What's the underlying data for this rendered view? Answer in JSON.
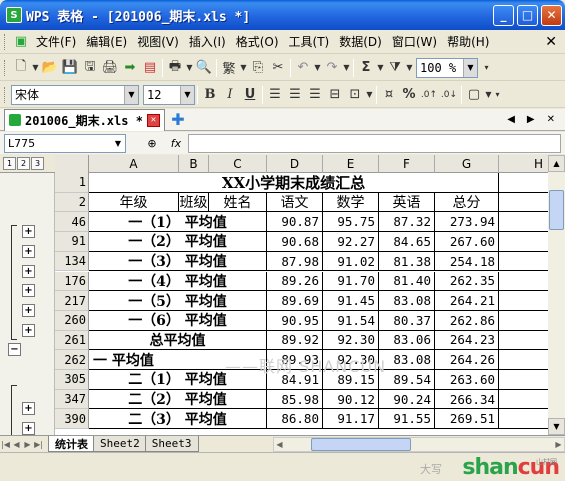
{
  "window": {
    "title": "WPS 表格 - [201006_期末.xls *]"
  },
  "menu": [
    "文件(F)",
    "编辑(E)",
    "视图(V)",
    "插入(I)",
    "格式(O)",
    "工具(T)",
    "数据(D)",
    "窗口(W)",
    "帮助(H)"
  ],
  "toolbar": {
    "zoom": "100 %",
    "font_name": "宋体",
    "font_size": "12",
    "bold": "B",
    "italic": "I",
    "underline": "U",
    "percent": "%",
    "sum": "Σ"
  },
  "doc_tab": {
    "label": "201006_期末.xls *"
  },
  "formula_bar": {
    "cell_ref": "L775",
    "fx_label": "fx",
    "formula": ""
  },
  "outline_levels": [
    "1",
    "2",
    "3"
  ],
  "columns": [
    "A",
    "B",
    "C",
    "D",
    "E",
    "F",
    "G",
    "H"
  ],
  "sheet": {
    "title": "XX小学期末成绩汇总",
    "header": [
      "年级",
      "班级",
      "姓名",
      "语文",
      "数学",
      "英语",
      "总分"
    ],
    "rows": [
      {
        "row": "46",
        "label": "一（1） 平均值",
        "v": [
          "90.87",
          "95.75",
          "87.32",
          "273.94"
        ]
      },
      {
        "row": "91",
        "label": "一（2） 平均值",
        "v": [
          "90.68",
          "92.27",
          "84.65",
          "267.60"
        ]
      },
      {
        "row": "134",
        "label": "一（3） 平均值",
        "v": [
          "87.98",
          "91.02",
          "81.38",
          "254.18"
        ]
      },
      {
        "row": "176",
        "label": "一（4） 平均值",
        "v": [
          "89.26",
          "91.70",
          "81.40",
          "262.35"
        ]
      },
      {
        "row": "217",
        "label": "一（5） 平均值",
        "v": [
          "89.69",
          "91.45",
          "83.08",
          "264.21"
        ]
      },
      {
        "row": "260",
        "label": "一（6） 平均值",
        "v": [
          "90.95",
          "91.54",
          "80.37",
          "262.86"
        ]
      },
      {
        "row": "261",
        "label": "总平均值",
        "v": [
          "89.92",
          "92.30",
          "83.06",
          "264.23"
        ]
      },
      {
        "row": "262",
        "label": "一 平均值",
        "v": [
          "89.93",
          "92.30",
          "83.08",
          "264.26"
        ]
      },
      {
        "row": "305",
        "label": "二（1） 平均值",
        "v": [
          "84.91",
          "89.15",
          "89.54",
          "263.60"
        ]
      },
      {
        "row": "347",
        "label": "二（2） 平均值",
        "v": [
          "85.98",
          "90.12",
          "90.24",
          "266.34"
        ]
      },
      {
        "row": "390",
        "label": "二（3） 平均值",
        "v": [
          "86.80",
          "91.17",
          "91.55",
          "269.51"
        ]
      }
    ]
  },
  "watermark": "——联网 SHANCUN",
  "sheet_tabs": [
    "统计表",
    "Sheet2",
    "Sheet3"
  ],
  "status": {
    "text": "大写"
  },
  "site_logo": {
    "main1": "shan",
    "main2": "cun",
    "sub": "山村网"
  }
}
